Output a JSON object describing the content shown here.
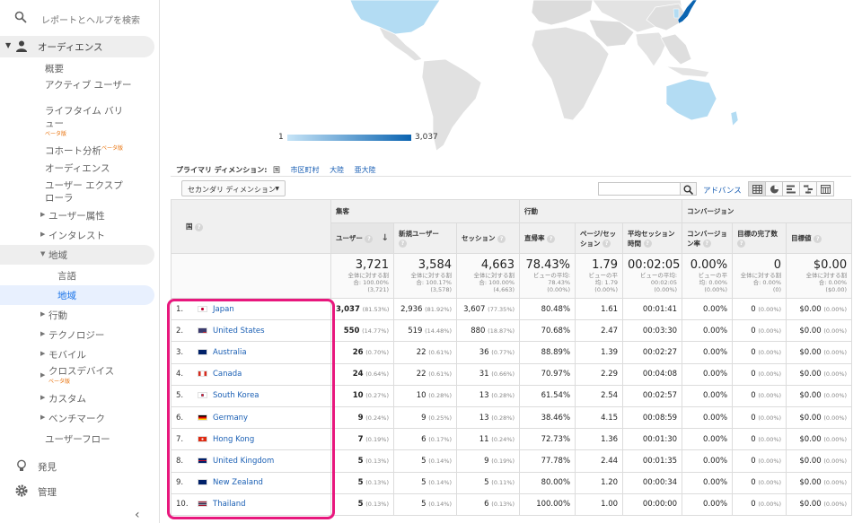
{
  "sidebar": {
    "search_placeholder": "レポートとヘルプを検索",
    "audience": "オーディエンス",
    "items": [
      "概要",
      "アクティブ ユーザー",
      "ライフタイム バリ",
      "ュー",
      "コホート分析",
      "オーディエンス",
      "ユーザー エクスプ",
      "ローラ"
    ],
    "beta": "ベータ版",
    "sub": [
      "ユーザー属性",
      "インタレスト",
      "地域",
      "言語",
      "地域",
      "行動",
      "テクノロジー",
      "モバイル",
      "クロスデバイス",
      "カスタム",
      "ベンチマーク",
      "ユーザーフロー"
    ],
    "discover": "発見",
    "admin": "管理",
    "collapse": "‹"
  },
  "map": {
    "legend_min": "1",
    "legend_max": "3,037"
  },
  "dimension": {
    "label": "プライマリ ディメンション:",
    "current": "国",
    "links": [
      "市区町村",
      "大陸",
      "亜大陸"
    ]
  },
  "toolbar": {
    "secondary": "セカンダリ ディメンション",
    "advance": "アドバンス"
  },
  "table": {
    "dim_header": "国",
    "groups": [
      "集客",
      "行動",
      "コンバージョン"
    ],
    "headers": [
      "ユーザー",
      "新規ユーザー",
      "セッション",
      "直帰率",
      "ページ/セッション",
      "平均セッション時間",
      "コンバージョン率",
      "目標の完了数",
      "目標値"
    ],
    "totals": [
      {
        "v": "3,721",
        "s1": "全体に対する割",
        "s2": "合: 100.00%",
        "s3": "(3,721)"
      },
      {
        "v": "3,584",
        "s1": "全体に対する割",
        "s2": "合: 100.17%",
        "s3": "(3,578)"
      },
      {
        "v": "4,663",
        "s1": "全体に対する割",
        "s2": "合: 100.00%",
        "s3": "(4,663)"
      },
      {
        "v": "78.43%",
        "s1": "ビューの平均:",
        "s2": "78.43%",
        "s3": "(0.00%)"
      },
      {
        "v": "1.79",
        "s1": "ビューの平",
        "s2": "均: 1.79",
        "s3": "(0.00%)"
      },
      {
        "v": "00:02:05",
        "s1": "ビューの平均:",
        "s2": "00:02:05",
        "s3": "(0.00%)"
      },
      {
        "v": "0.00%",
        "s1": "ビューの平",
        "s2": "均: 0.00%",
        "s3": "(0.00%)"
      },
      {
        "v": "0",
        "s1": "全体に対する割",
        "s2": "合: 0.00%",
        "s3": "(0)"
      },
      {
        "v": "$0.00",
        "s1": "全体に対する割",
        "s2": "合: 0.00%",
        "s3": "($0.00)"
      }
    ],
    "rows": [
      {
        "rank": "1.",
        "country": "Japan",
        "users": "3,037",
        "users_pct": "(81.53%)",
        "new": "2,936",
        "new_pct": "(81.92%)",
        "sess": "3,607",
        "sess_pct": "(77.35%)",
        "bounce": "80.48%",
        "pps": "1.61",
        "dur": "00:01:41",
        "conv": "0.00%",
        "goals": "0",
        "goals_pct": "(0.00%)",
        "val": "$0.00",
        "val_pct": "(0.00%)"
      },
      {
        "rank": "2.",
        "country": "United States",
        "users": "550",
        "users_pct": "(14.77%)",
        "new": "519",
        "new_pct": "(14.48%)",
        "sess": "880",
        "sess_pct": "(18.87%)",
        "bounce": "70.68%",
        "pps": "2.47",
        "dur": "00:03:30",
        "conv": "0.00%",
        "goals": "0",
        "goals_pct": "(0.00%)",
        "val": "$0.00",
        "val_pct": "(0.00%)"
      },
      {
        "rank": "3.",
        "country": "Australia",
        "users": "26",
        "users_pct": "(0.70%)",
        "new": "22",
        "new_pct": "(0.61%)",
        "sess": "36",
        "sess_pct": "(0.77%)",
        "bounce": "88.89%",
        "pps": "1.39",
        "dur": "00:02:27",
        "conv": "0.00%",
        "goals": "0",
        "goals_pct": "(0.00%)",
        "val": "$0.00",
        "val_pct": "(0.00%)"
      },
      {
        "rank": "4.",
        "country": "Canada",
        "users": "24",
        "users_pct": "(0.64%)",
        "new": "22",
        "new_pct": "(0.61%)",
        "sess": "31",
        "sess_pct": "(0.66%)",
        "bounce": "70.97%",
        "pps": "2.29",
        "dur": "00:04:08",
        "conv": "0.00%",
        "goals": "0",
        "goals_pct": "(0.00%)",
        "val": "$0.00",
        "val_pct": "(0.00%)"
      },
      {
        "rank": "5.",
        "country": "South Korea",
        "users": "10",
        "users_pct": "(0.27%)",
        "new": "10",
        "new_pct": "(0.28%)",
        "sess": "13",
        "sess_pct": "(0.28%)",
        "bounce": "61.54%",
        "pps": "2.54",
        "dur": "00:02:57",
        "conv": "0.00%",
        "goals": "0",
        "goals_pct": "(0.00%)",
        "val": "$0.00",
        "val_pct": "(0.00%)"
      },
      {
        "rank": "6.",
        "country": "Germany",
        "users": "9",
        "users_pct": "(0.24%)",
        "new": "9",
        "new_pct": "(0.25%)",
        "sess": "13",
        "sess_pct": "(0.28%)",
        "bounce": "38.46%",
        "pps": "4.15",
        "dur": "00:08:59",
        "conv": "0.00%",
        "goals": "0",
        "goals_pct": "(0.00%)",
        "val": "$0.00",
        "val_pct": "(0.00%)"
      },
      {
        "rank": "7.",
        "country": "Hong Kong",
        "users": "7",
        "users_pct": "(0.19%)",
        "new": "6",
        "new_pct": "(0.17%)",
        "sess": "11",
        "sess_pct": "(0.24%)",
        "bounce": "72.73%",
        "pps": "1.36",
        "dur": "00:01:30",
        "conv": "0.00%",
        "goals": "0",
        "goals_pct": "(0.00%)",
        "val": "$0.00",
        "val_pct": "(0.00%)"
      },
      {
        "rank": "8.",
        "country": "United Kingdom",
        "users": "5",
        "users_pct": "(0.13%)",
        "new": "5",
        "new_pct": "(0.14%)",
        "sess": "9",
        "sess_pct": "(0.19%)",
        "bounce": "77.78%",
        "pps": "2.44",
        "dur": "00:01:35",
        "conv": "0.00%",
        "goals": "0",
        "goals_pct": "(0.00%)",
        "val": "$0.00",
        "val_pct": "(0.00%)"
      },
      {
        "rank": "9.",
        "country": "New Zealand",
        "users": "5",
        "users_pct": "(0.13%)",
        "new": "5",
        "new_pct": "(0.14%)",
        "sess": "5",
        "sess_pct": "(0.11%)",
        "bounce": "80.00%",
        "pps": "1.20",
        "dur": "00:00:34",
        "conv": "0.00%",
        "goals": "0",
        "goals_pct": "(0.00%)",
        "val": "$0.00",
        "val_pct": "(0.00%)"
      },
      {
        "rank": "10.",
        "country": "Thailand",
        "users": "5",
        "users_pct": "(0.13%)",
        "new": "5",
        "new_pct": "(0.14%)",
        "sess": "6",
        "sess_pct": "(0.13%)",
        "bounce": "100.00%",
        "pps": "1.00",
        "dur": "00:00:00",
        "conv": "0.00%",
        "goals": "0",
        "goals_pct": "(0.00%)",
        "val": "$0.00",
        "val_pct": "(0.00%)"
      }
    ]
  },
  "colors": {
    "highlight": "#e8177d",
    "link": "#1a5fb4",
    "map_dark": "#0b64b1",
    "map_light": "#b3dcf3"
  }
}
